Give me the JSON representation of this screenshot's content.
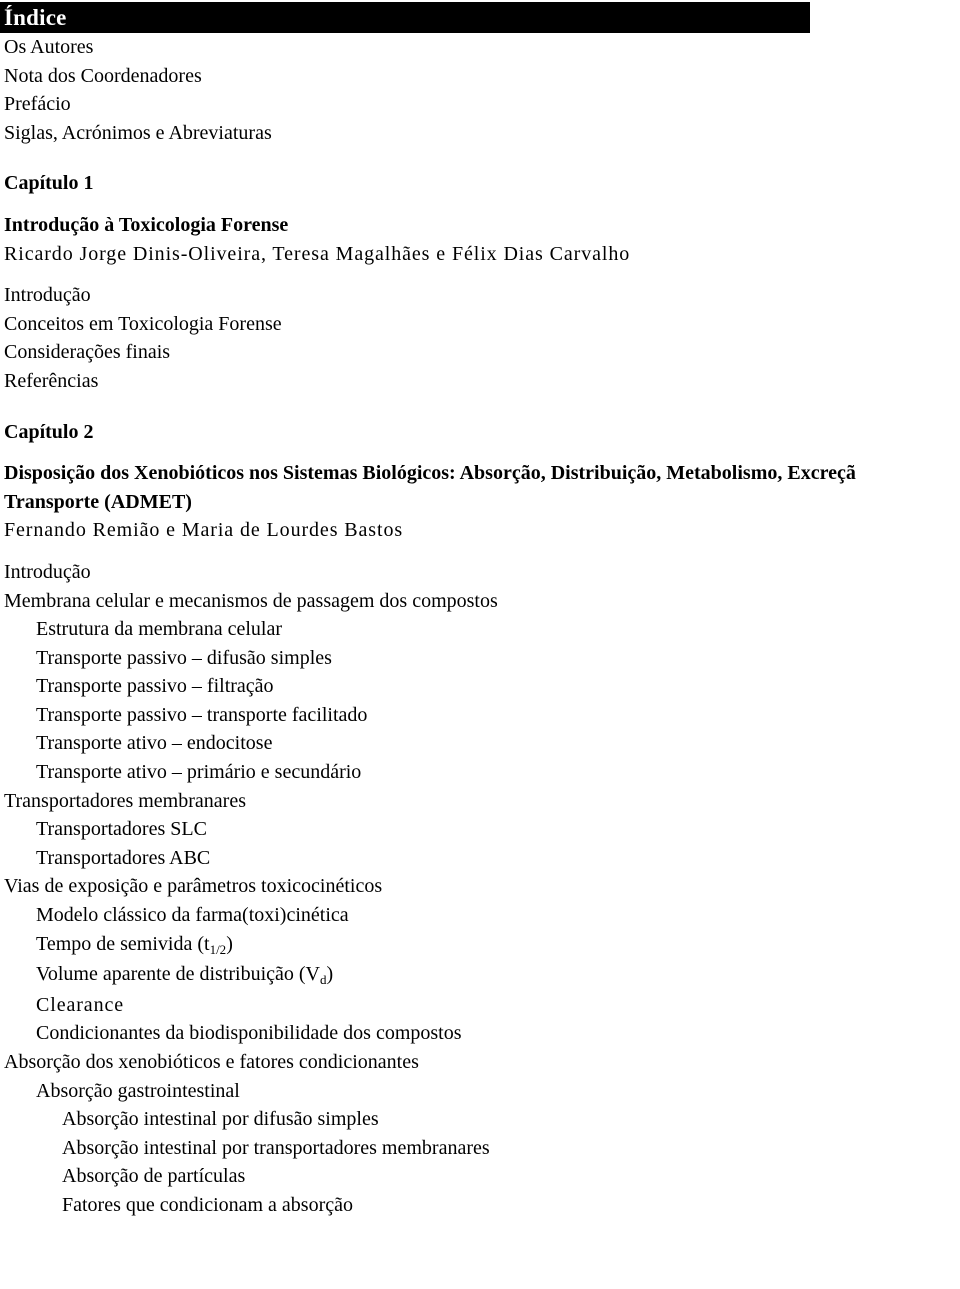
{
  "document": {
    "header": {
      "title": "Índice"
    },
    "front_matter": [
      "Os Autores",
      "Nota dos Coordenadores",
      "Prefácio",
      "Siglas, Acrónimos e Abreviaturas"
    ],
    "chapters": [
      {
        "label": "Capítulo 1",
        "title": "Introdução à Toxicologia Forense",
        "authors": "Ricardo Jorge Dinis-Oliveira, Teresa Magalhães e Félix Dias Carvalho",
        "entries": [
          {
            "text": "Introdução",
            "level": 0
          },
          {
            "text": "Conceitos em Toxicologia Forense",
            "level": 0
          },
          {
            "text": "Considerações finais",
            "level": 0
          },
          {
            "text": "Referências",
            "level": 0
          }
        ]
      },
      {
        "label": "Capítulo 2",
        "title_line1": "Disposição dos Xenobióticos nos Sistemas Biológicos: Absorção, Distribuição, Metabolismo, Excreçã",
        "title_line2": "Transporte (ADMET)",
        "authors": "Fernando Remião e Maria de Lourdes Bastos",
        "entries": [
          {
            "text": "Introdução",
            "level": 0
          },
          {
            "text": "Membrana celular e mecanismos de passagem dos compostos",
            "level": 0
          },
          {
            "text": "Estrutura da membrana celular",
            "level": 1
          },
          {
            "text": "Transporte passivo – difusão simples",
            "level": 1
          },
          {
            "text": "Transporte passivo – filtração",
            "level": 1
          },
          {
            "text": "Transporte passivo – transporte facilitado",
            "level": 1
          },
          {
            "text": "Transporte ativo – endocitose",
            "level": 1
          },
          {
            "text": "Transporte ativo – primário e secundário",
            "level": 1
          },
          {
            "text": "Transportadores membranares",
            "level": 0
          },
          {
            "text": "Transportadores SLC",
            "level": 1
          },
          {
            "text": "Transportadores ABC",
            "level": 1
          },
          {
            "text": "Vias de exposição e parâmetros toxicocinéticos",
            "level": 0
          },
          {
            "text": "Modelo clássico da farma(toxi)cinética",
            "level": 1
          },
          {
            "text": "Tempo de semivida (t<sub>1/2</sub>)",
            "level": 1,
            "html": true
          },
          {
            "text": "Volume aparente de distribuição (V<sub>d</sub>)",
            "level": 1,
            "html": true
          },
          {
            "text": "Clearance",
            "level": 1,
            "spaced": true
          },
          {
            "text": "Condicionantes da biodisponibilidade dos compostos",
            "level": 1
          },
          {
            "text": "Absorção dos xenobióticos e fatores condicionantes",
            "level": 0
          },
          {
            "text": "Absorção gastrointestinal",
            "level": 1
          },
          {
            "text": "Absorção intestinal por difusão simples",
            "level": 2
          },
          {
            "text": "Absorção intestinal por transportadores membranares",
            "level": 2
          },
          {
            "text": "Absorção de partículas",
            "level": 2
          },
          {
            "text": "Fatores que condicionam a absorção",
            "level": 2
          }
        ]
      }
    ]
  }
}
